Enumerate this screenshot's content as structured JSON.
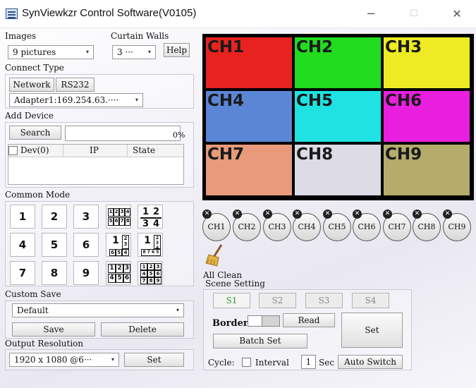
{
  "window": {
    "title": "SynViewkzr Control Software(V0105)",
    "minimize": "─",
    "maximize": "☐",
    "close": "✕"
  },
  "images": {
    "label": "Images",
    "value": "9 pictures",
    "arrow": "▾"
  },
  "curtain": {
    "label": "Curtain Walls",
    "value": "3 ···",
    "arrow": "▾",
    "help": "Help"
  },
  "connect": {
    "label": "Connect Type",
    "tabs": [
      "Network",
      "RS232"
    ],
    "adapter": "Adapter1:169.254.63.····",
    "arrow": "▾"
  },
  "device": {
    "label": "Add Device",
    "search": "Search",
    "search_value": "",
    "percent": "0%",
    "columns": [
      "Dev(0)",
      "IP",
      "State"
    ]
  },
  "common_mode": {
    "label": "Common Mode",
    "numbers": [
      "1",
      "2",
      "3",
      "4",
      "5",
      "6",
      "7",
      "8",
      "9"
    ]
  },
  "custom_save": {
    "label": "Custom Save",
    "value": "Default",
    "arrow": "▾",
    "save": "Save",
    "delete": "Delete"
  },
  "output": {
    "label": "Output Resolution",
    "value": "1920 x 1080 @6···",
    "arrow": "▾",
    "set": "Set"
  },
  "channels": {
    "cells": [
      {
        "label": "CH1",
        "color": "#e8231f"
      },
      {
        "label": "CH2",
        "color": "#21dc1f"
      },
      {
        "label": "CH3",
        "color": "#eeeb24"
      },
      {
        "label": "CH4",
        "color": "#5b86d6"
      },
      {
        "label": "CH5",
        "color": "#1fe2e2"
      },
      {
        "label": "CH6",
        "color": "#e81fde"
      },
      {
        "label": "CH7",
        "color": "#e89a7a"
      },
      {
        "label": "CH8",
        "color": "#dcdbe6"
      },
      {
        "label": "CH9",
        "color": "#b5ac6c"
      }
    ],
    "buttons": [
      "CH1",
      "CH2",
      "CH3",
      "CH4",
      "CH5",
      "CH6",
      "CH7",
      "CH8",
      "CH9"
    ],
    "remove_glyph": "✕"
  },
  "all_clean": "All Clean",
  "scene": {
    "label": "Scene Setting",
    "tabs": [
      "S1",
      "S2",
      "S3",
      "S4"
    ],
    "active_color": "#2a9a2a",
    "border": "Border",
    "read": "Read",
    "set": "Set",
    "batch_set": "Batch Set",
    "cycle": "Cycle:",
    "interval": "Interval",
    "interval_value": "1",
    "sec": "Sec",
    "auto_switch": "Auto Switch"
  }
}
